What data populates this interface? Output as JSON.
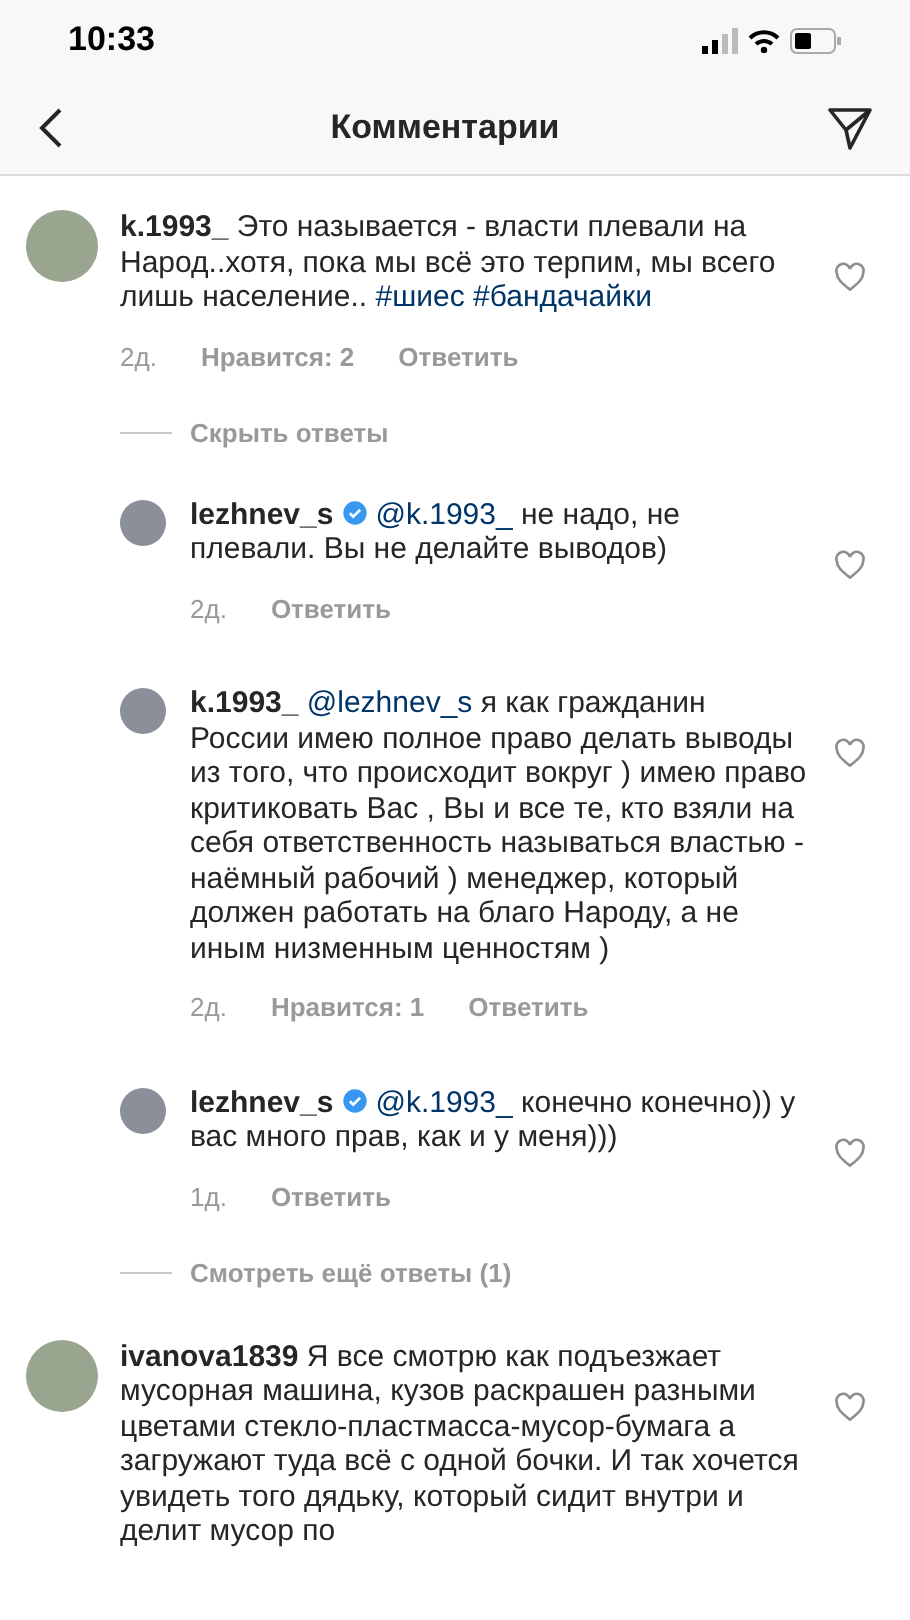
{
  "status_bar": {
    "time": "10:33"
  },
  "header": {
    "title": "Комментарии"
  },
  "comments": [
    {
      "kind": "comment",
      "username": "k.1993_",
      "verified": false,
      "text": [
        {
          "kind": "plain",
          "text": "Это называется - власти плевали на Народ..хотя, пока мы всё это терпим, мы всего лишь население.. "
        },
        {
          "kind": "link",
          "text": "#шиес"
        },
        {
          "kind": "link",
          "text": "#бандачайки"
        }
      ],
      "time": "2д.",
      "likes": "Нравится: 2",
      "reply": "Ответить",
      "liked": false
    },
    {
      "kind": "toggle",
      "text": "Скрыть ответы"
    },
    {
      "kind": "reply",
      "username": "lezhnev_s",
      "verified": true,
      "text": [
        {
          "kind": "link",
          "text": "@k.1993_"
        },
        {
          "kind": "plain",
          "text": " не надо, не плевали. Вы не делайте выводов)"
        }
      ],
      "time": "2д.",
      "reply": "Ответить",
      "liked": false
    },
    {
      "kind": "reply",
      "username": "k.1993_",
      "verified": false,
      "text": [
        {
          "kind": "link",
          "text": "@lezhnev_s"
        },
        {
          "kind": "plain",
          "text": " я как гражданин России имею полное право делать выводы из того, что происходит вокруг ) имею право критиковать Вас , Вы и все те, кто взяли на себя ответственность называться властью - наёмный рабочий ) менеджер, который должен работать на благо Народу, а не иным низменным ценностям )"
        }
      ],
      "time": "2д.",
      "likes": "Нравится: 1",
      "reply": "Ответить",
      "liked": false
    },
    {
      "kind": "reply",
      "username": "lezhnev_s",
      "verified": true,
      "text": [
        {
          "kind": "link",
          "text": "@k.1993_"
        },
        {
          "kind": "plain",
          "text": " конечно конечно)) у вас много прав, как и у меня)))"
        }
      ],
      "time": "1д.",
      "reply": "Ответить",
      "liked": false
    },
    {
      "kind": "toggle",
      "text": "Смотреть ещё ответы (1)"
    },
    {
      "kind": "comment",
      "username": "ivanova1839",
      "verified": false,
      "text": [
        {
          "kind": "plain",
          "text": "Я все смотрю как подъезжает мусорная машина, кузов раскрашен разными цветами стекло-пластмасса-мусор-бумага а загружают туда всё с одной бочки. И так хочется увидеть того дядьку, который сидит внутри и делит мусор по"
        }
      ],
      "liked": false
    }
  ]
}
